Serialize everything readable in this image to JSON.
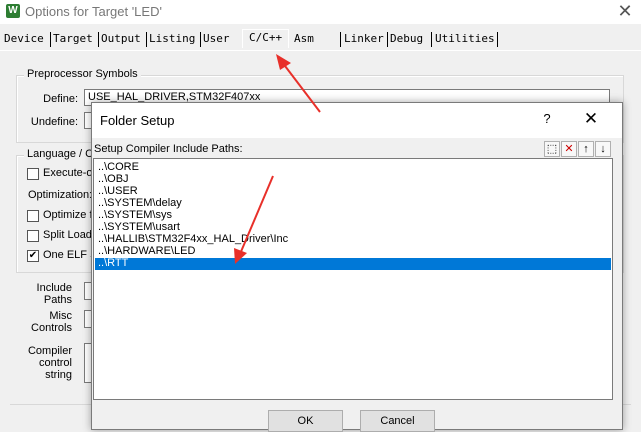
{
  "window": {
    "title": "Options for Target 'LED'",
    "close_glyph": "✕",
    "icon_letter": "W"
  },
  "tabs": [
    "Device",
    "Target",
    "Output",
    "Listing",
    "User",
    "C/C++",
    "Asm",
    "Linker",
    "Debug",
    "Utilities"
  ],
  "active_tab": "C/C++",
  "preprocessor": {
    "group_title": "Preprocessor Symbols",
    "define_label": "Define:",
    "define_value": "USE_HAL_DRIVER,STM32F407xx",
    "undefine_label": "Undefine:",
    "undefine_value": ""
  },
  "language": {
    "group_title": "Language / C",
    "execute_only": "Execute-o",
    "optimization_label": "Optimization:",
    "optimize_for": "Optimize fo",
    "split_load": "Split Load",
    "one_elf": "One ELF S",
    "one_elf_checked": true
  },
  "lower_fields": {
    "include_paths": [
      "Include",
      "Paths"
    ],
    "misc_controls": [
      "Misc",
      "Controls"
    ],
    "compiler_control": [
      "Compiler",
      "control",
      "string"
    ]
  },
  "folder_dialog": {
    "title": "Folder Setup",
    "help_glyph": "?",
    "close_glyph": "✕",
    "header_label": "Setup Compiler Include Paths:",
    "toolbar_icons": [
      "new-folder-icon",
      "delete-icon",
      "move-up-icon",
      "move-down-icon"
    ],
    "toolbar_glyphs": [
      "⬚",
      "✕",
      "↑",
      "↓"
    ],
    "paths": [
      "..\\CORE",
      "..\\OBJ",
      "..\\USER",
      "..\\SYSTEM\\delay",
      "..\\SYSTEM\\sys",
      "..\\SYSTEM\\usart",
      "..\\HALLIB\\STM32F4xx_HAL_Driver\\Inc",
      "..\\HARDWARE\\LED",
      "..\\RTT"
    ],
    "selected_index": 8,
    "ok_label": "OK",
    "cancel_label": "Cancel"
  },
  "colors": {
    "selection": "#0078d7",
    "annotation_arrow": "#e8302a",
    "app_icon": "#2d7d32"
  }
}
